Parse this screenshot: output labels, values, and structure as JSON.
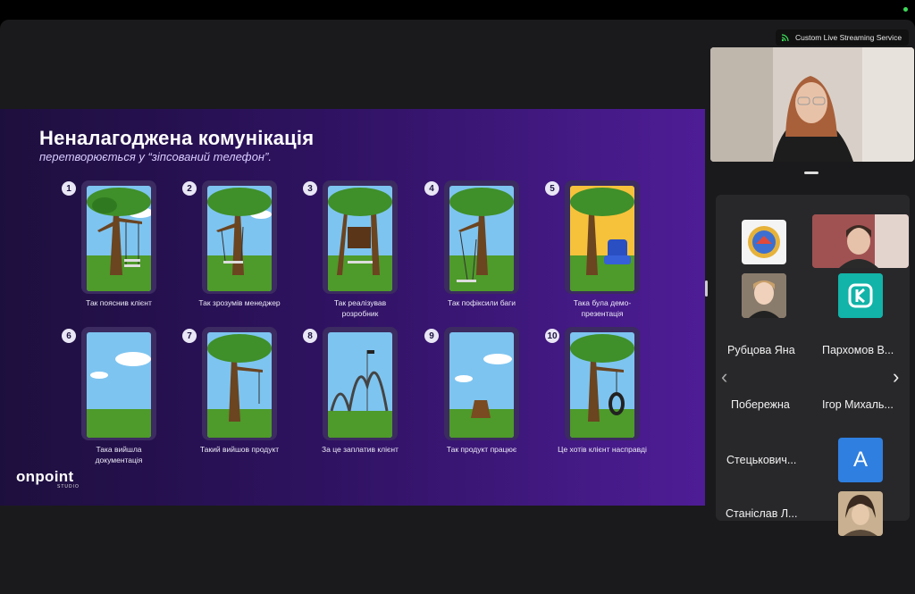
{
  "stream": {
    "label": "Custom Live Streaming Service"
  },
  "slide": {
    "title": "Неналагоджена комунікація",
    "subtitle": "перетворюється у “зіпсований телефон”.",
    "logo": "onpoint",
    "logo_sub": "STUDIO",
    "cards": [
      {
        "num": "1",
        "caption": "Так пояснив клієнт"
      },
      {
        "num": "2",
        "caption": "Так зрозумів менеджер"
      },
      {
        "num": "3",
        "caption": "Так реалізував розробник"
      },
      {
        "num": "4",
        "caption": "Так пофіксили баги"
      },
      {
        "num": "5",
        "caption": "Така була демо-презентація"
      },
      {
        "num": "6",
        "caption": "Така вийшла документація"
      },
      {
        "num": "7",
        "caption": "Такий вийшов продукт"
      },
      {
        "num": "8",
        "caption": "За це заплатив клієнт"
      },
      {
        "num": "9",
        "caption": "Так продукт працює"
      },
      {
        "num": "10",
        "caption": "Це хотів клієнт насправді"
      }
    ]
  },
  "participants": [
    {
      "name": "Рубцова Яна",
      "avatar": "logo-badge-icon"
    },
    {
      "name": "Пархомов В...",
      "avatar": "video-thumbnail"
    },
    {
      "name": "Побережна",
      "avatar": "photo-avatar"
    },
    {
      "name": "Ігор Михаль...",
      "avatar": "k-logo-icon"
    },
    {
      "name": "Стецькович...",
      "avatar": ""
    },
    {
      "name": "",
      "avatar": "A"
    },
    {
      "name": "Станіслав Л...",
      "avatar": "anime-avatar"
    }
  ],
  "colors": {
    "accent_teal": "#00b3a7",
    "avatar_blue": "#2f7fe0",
    "slide_purple": "#4e1d96"
  }
}
